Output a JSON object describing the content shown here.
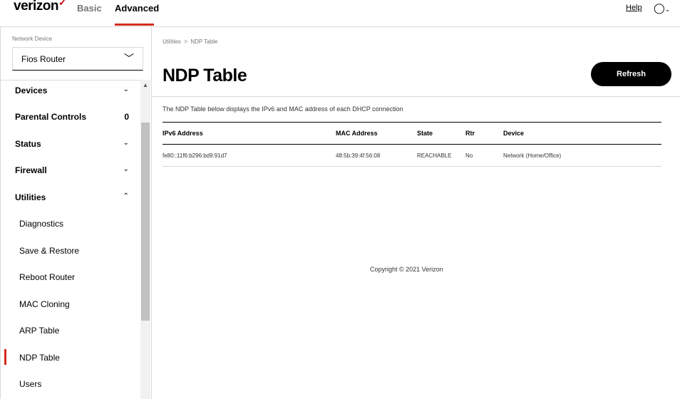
{
  "header": {
    "brand": "verizon",
    "brand_mark": "✓",
    "tabs": [
      {
        "label": "Basic"
      },
      {
        "label": "Advanced"
      }
    ],
    "help": "Help",
    "user_icon": "user-icon"
  },
  "sidebar": {
    "network_device_label": "Network Device",
    "network_device_value": "Fios Router",
    "menu": [
      {
        "label": "Devices",
        "indicator": "⌄"
      },
      {
        "label": "Parental Controls",
        "indicator": "0"
      },
      {
        "label": "Status",
        "indicator": "⌄"
      },
      {
        "label": "Firewall",
        "indicator": "⌄"
      },
      {
        "label": "Utilities",
        "indicator": "⌃"
      }
    ],
    "utilities": [
      {
        "label": "Diagnostics"
      },
      {
        "label": "Save & Restore"
      },
      {
        "label": "Reboot Router"
      },
      {
        "label": "MAC Cloning"
      },
      {
        "label": "ARP Table"
      },
      {
        "label": "NDP Table"
      },
      {
        "label": "Users"
      }
    ],
    "active": "NDP Table"
  },
  "main": {
    "breadcrumb": [
      "Utilities",
      "NDP Table"
    ],
    "breadcrumb_sep": ">",
    "title": "NDP Table",
    "refresh": "Refresh",
    "description": "The NDP Table below displays the IPv6 and MAC address of each DHCP connection",
    "columns": [
      "IPv6 Address",
      "MAC Address",
      "State",
      "Rtr",
      "Device"
    ],
    "rows": [
      [
        "fe80::11f6:b296:bd9:91d7",
        "48:5b:39:4f:56:08",
        "REACHABLE",
        "No",
        "Network (Home/Office)"
      ]
    ]
  },
  "footer": {
    "copyright": "Copyright © 2021 Verizon"
  }
}
